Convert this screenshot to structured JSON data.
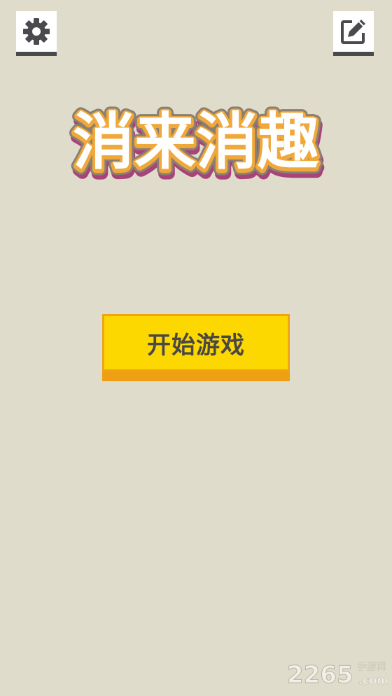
{
  "toolbar": {
    "settings_icon": "gear-icon",
    "edit_icon": "edit-icon"
  },
  "title": {
    "text": "消来消趣",
    "fill_color": "#ffffff",
    "inner_outline_color": "#f0a83a",
    "outer_outline_color": "#8a7f72",
    "shadow_color": "#a7437a"
  },
  "start_button": {
    "label": "开始游戏",
    "face_color": "#fdd800",
    "border_color": "#f0a414"
  },
  "watermark": {
    "number": "2265",
    "cn": "手游网",
    "domain": ".com"
  },
  "colors": {
    "background": "#e0dccb",
    "icon_dark": "#4a4a4e"
  }
}
